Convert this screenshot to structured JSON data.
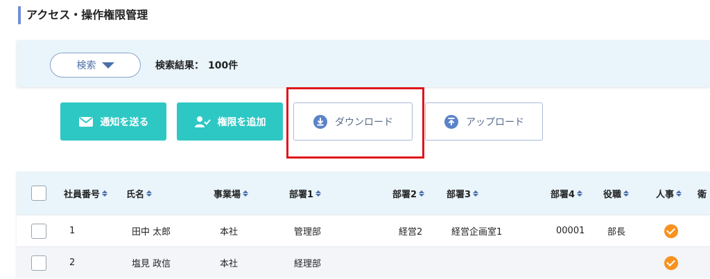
{
  "page": {
    "title": "アクセス・操作権限管理"
  },
  "search": {
    "toggle_label": "検索",
    "result_label": "検索結果：",
    "result_count": "100件"
  },
  "actions": {
    "notify_label": "通知を送る",
    "add_permission_label": "権限を追加",
    "download_label": "ダウンロード",
    "upload_label": "アップロード"
  },
  "colors": {
    "accent_teal": "#2ec8c4",
    "highlight_red": "#e0141a",
    "badge_orange": "#f7921e",
    "header_bg": "#e9f4fb"
  },
  "table": {
    "headers": [
      "社員番号",
      "氏名",
      "事業場",
      "部署1",
      "部署2",
      "部署3",
      "部署4",
      "役職",
      "人事",
      "衛"
    ],
    "rows": [
      {
        "id": "1",
        "name": "田中 太郎",
        "site": "本社",
        "dept1": "管理部",
        "dept2": "経営2",
        "dept3": "経営企画室1",
        "dept4": "00001",
        "position": "部長",
        "hr": true
      },
      {
        "id": "2",
        "name": "塩見 政信",
        "site": "本社",
        "dept1": "経理部",
        "dept2": "",
        "dept3": "",
        "dept4": "",
        "position": "",
        "hr": true
      }
    ]
  }
}
